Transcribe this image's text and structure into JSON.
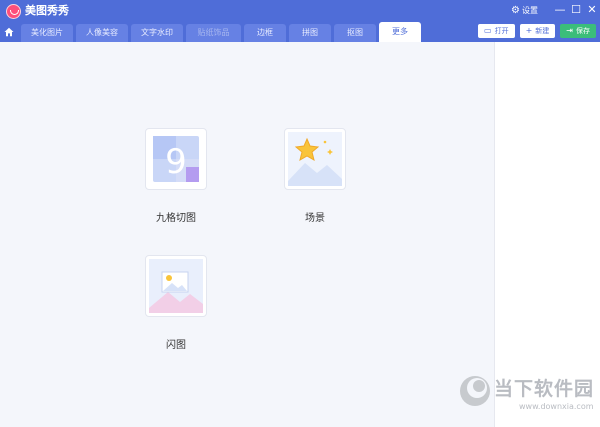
{
  "app": {
    "title": "美图秀秀"
  },
  "window": {
    "settings_label": "设置",
    "minimize_glyph": "—",
    "maximize_glyph": "☐",
    "close_glyph": "✕"
  },
  "tabs": [
    {
      "label": "美化图片",
      "state": "normal"
    },
    {
      "label": "人像美容",
      "state": "normal"
    },
    {
      "label": "文字水印",
      "state": "normal"
    },
    {
      "label": "贴纸饰品",
      "state": "disabled"
    },
    {
      "label": "边框",
      "state": "normal"
    },
    {
      "label": "拼图",
      "state": "normal"
    },
    {
      "label": "抠图",
      "state": "normal"
    },
    {
      "label": "更多",
      "state": "active"
    }
  ],
  "toolbar": {
    "open_label": "打开",
    "new_label": "新建",
    "save_label": "保存"
  },
  "tools": [
    {
      "label": "九格切图",
      "icon": "nine-grid-icon",
      "number": "9"
    },
    {
      "label": "场景",
      "icon": "scene-icon"
    },
    {
      "label": "闪图",
      "icon": "flash-image-icon"
    }
  ],
  "watermark": {
    "text": "当下软件园",
    "url": "www.downxia.com"
  },
  "colors": {
    "topbar": "#4f6dd8",
    "accent": "#4f6dd8",
    "save": "#3bbd7a",
    "logo": "#ff4f7b"
  }
}
